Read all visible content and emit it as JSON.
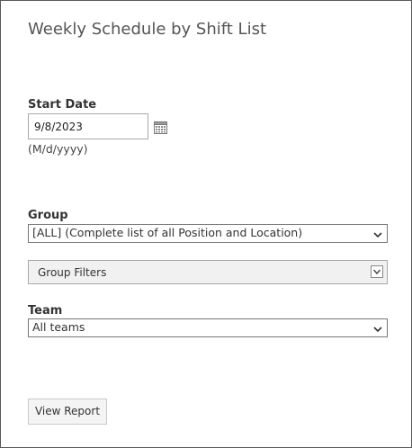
{
  "page": {
    "title": "Weekly Schedule by Shift List"
  },
  "start_date": {
    "label": "Start Date",
    "value": "9/8/2023",
    "format_hint": "(M/d/yyyy)",
    "icon": "calendar-icon"
  },
  "group": {
    "label": "Group",
    "selected": "[ALL] (Complete list of all Position and Location)",
    "icon": "chevron-down-icon"
  },
  "group_filters": {
    "label": "Group Filters",
    "icon": "chevron-down-icon"
  },
  "team": {
    "label": "Team",
    "selected": "All teams",
    "icon": "chevron-down-icon"
  },
  "actions": {
    "view_report_label": "View Report"
  }
}
